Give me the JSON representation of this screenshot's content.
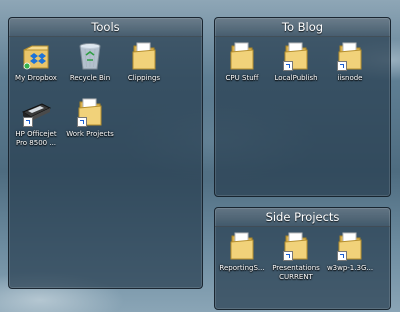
{
  "fences": {
    "tools": {
      "title": "Tools",
      "items": [
        {
          "label": "My Dropbox",
          "icon": "dropbox-icon"
        },
        {
          "label": "Recycle Bin",
          "icon": "recycle-bin-icon"
        },
        {
          "label": "Clippings",
          "icon": "folder-icon"
        },
        {
          "label": "HP Officejet Pro 8500 ...",
          "icon": "printer-icon"
        },
        {
          "label": "Work Projects",
          "icon": "folder-shortcut-icon"
        }
      ]
    },
    "to_blog": {
      "title": "To Blog",
      "items": [
        {
          "label": "CPU Stuff",
          "icon": "folder-icon"
        },
        {
          "label": "LocalPublish",
          "icon": "folder-shortcut-icon"
        },
        {
          "label": "iisnode",
          "icon": "folder-shortcut-icon"
        }
      ]
    },
    "side_projects": {
      "title": "Side Projects",
      "items": [
        {
          "label": "ReportingS...",
          "icon": "folder-icon"
        },
        {
          "label": "Presentations CURRENT",
          "icon": "folder-shortcut-icon"
        },
        {
          "label": "w3wp-1.3G...",
          "icon": "folder-shortcut-icon"
        }
      ]
    }
  },
  "colors": {
    "fence_bg": "#283e50",
    "folder": "#f1d27a",
    "label_text": "#ffffff"
  }
}
